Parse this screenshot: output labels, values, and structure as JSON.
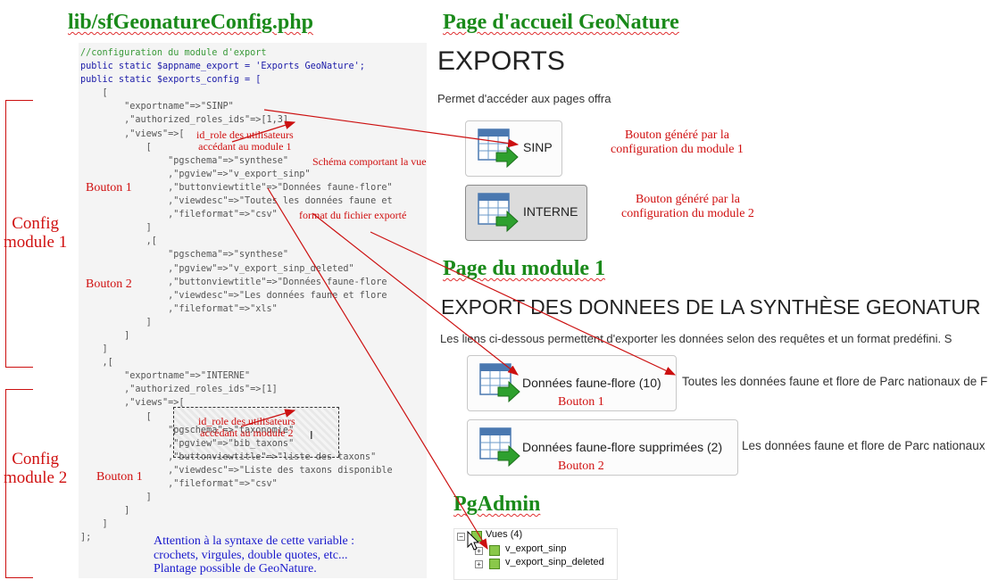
{
  "headings": {
    "config_file": "lib/sfGeonatureConfig.php",
    "home_page": "Page d'accueil GeoNature",
    "module_page": "Page du module 1",
    "pgadmin": "PgAdmin"
  },
  "code_lines": [
    "//configuration du module d'export",
    "public static $appname_export = 'Exports GeoNature';",
    "public static $exports_config = [",
    "    [",
    "        \"exportname\"=>\"SINP\"",
    "        ,\"authorized_roles_ids\"=>[1,3]",
    "        ,\"views\"=>[",
    "            [",
    "                \"pgschema\"=>\"synthese\"",
    "                ,\"pgview\"=>\"v_export_sinp\"",
    "                ,\"buttonviewtitle\"=>\"Données faune-flore\"",
    "                ,\"viewdesc\"=>\"Toutes les données faune et",
    "                ,\"fileformat\"=>\"csv\"",
    "            ]",
    "            ,[",
    "                \"pgschema\"=>\"synthese\"",
    "                ,\"pgview\"=>\"v_export_sinp_deleted\"",
    "                ,\"buttonviewtitle\"=>\"Données faune-flore",
    "                ,\"viewdesc\"=>\"Les données faune et flore",
    "                ,\"fileformat\"=>\"xls\"",
    "            ]",
    "        ]",
    "",
    "    ]",
    "    ,[",
    "        \"exportname\"=>\"INTERNE\"",
    "        ,\"authorized_roles_ids\"=>[1]",
    "        ,\"views\"=>[",
    "            [",
    "                \"pgschema\"=>\"taxonomie\"",
    "                ,\"pgview\"=>\"bib_taxons\"",
    "                ,\"buttonviewtitle\"=>\"liste des taxons\"",
    "                ,\"viewdesc\"=>\"Liste des taxons disponible",
    "                ,\"fileformat\"=>\"csv\"",
    "            ]",
    "        ]",
    "    ]",
    "];"
  ],
  "annotations": {
    "role_ids_1": [
      "id_role des utilisateurs",
      "accédant au module 1"
    ],
    "schema_note": "Schéma comportant la vue",
    "format_note": "format du fichier exporté",
    "role_ids_2": [
      "id_role des utilisateurs",
      "accédant au module 2"
    ],
    "bouton_1": "Bouton 1",
    "bouton_2": "Bouton 2",
    "config_module_1": [
      "Config",
      "module 1"
    ],
    "config_module_2": [
      "Config",
      "module 2"
    ],
    "generated_1": [
      "Bouton généré par la",
      "configuration du module 1"
    ],
    "generated_2": [
      "Bouton généré par la",
      "configuration du module 2"
    ],
    "warning": [
      "Attention à la syntaxe de cette variable :",
      "crochets, virgules, double quotes, etc...",
      "Plantage possible de GeoNature."
    ]
  },
  "home_page": {
    "title": "EXPORTS",
    "intro": "Permet d'accéder aux pages offra",
    "buttons": [
      {
        "label": "SINP"
      },
      {
        "label": "INTERNE"
      }
    ]
  },
  "module_page": {
    "title": "EXPORT DES DONNEES DE LA SYNTHÈSE GEONATUR",
    "intro": "Les liens ci-dessous permettent d'exporter les données selon des requêtes et un format predéfini. S",
    "buttons": [
      {
        "label": "Données faune-flore (10)",
        "desc": "Toutes les données faune et flore de Parc nationaux de F"
      },
      {
        "label": "Données faune-flore supprimées (2)",
        "desc": "Les données faune et flore de Parc nationaux"
      }
    ]
  },
  "pgadmin": {
    "root": "Vues (4)",
    "items": [
      "v_export_sinp",
      "v_export_sinp_deleted"
    ]
  },
  "colors": {
    "heading": "#1a8a1a",
    "annotation": "#d01010",
    "note": "#1a1acc",
    "arrow": "#cc1010"
  }
}
